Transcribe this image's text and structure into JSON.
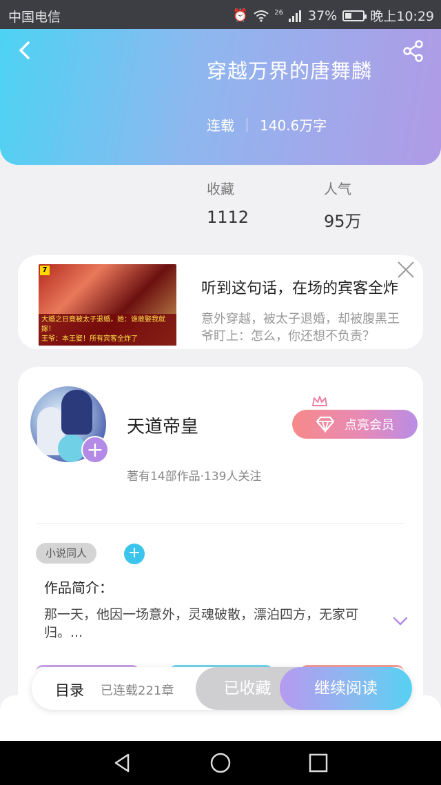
{
  "status_bar": {
    "carrier": "中国电信",
    "battery_pct": "37%",
    "time": "晚上10:29",
    "network": "26"
  },
  "header": {
    "title": "穿越万界的唐舞麟",
    "status": "连载",
    "word_count": "140.6万字"
  },
  "stats": [
    {
      "label": "收藏",
      "value": "1112"
    },
    {
      "label": "人气",
      "value": "95万"
    }
  ],
  "ad": {
    "headline": "听到这句话，在场的宾客全炸",
    "desc_line1": "意外穿越，被太子退婚，却被腹黑王",
    "desc_line2": "爷盯上：怎么，你还想不负责？",
    "image_caption_1": "大婚之日竟被太子退婚，她：谁敢娶我就嫁！",
    "image_caption_2": "王爷：本王娶！所有宾客全炸了"
  },
  "author": {
    "name": "天道帝皇",
    "stats": "著有14部作品·139人关注",
    "vip_label": "点亮会员"
  },
  "book": {
    "tag": "小说同人",
    "intro_label": "作品简介：",
    "intro_text": "那一天，他因一场意外，灵魂破散，漂泊四方，无家可归。..."
  },
  "bottom_bar": {
    "toc_label": "目录",
    "chapter_count": "已连载221章",
    "collected_label": "已收藏",
    "read_label": "继续阅读"
  },
  "colors": {
    "header_gradient_start": "#4dd3f3",
    "header_gradient_end": "#b09ae6",
    "accent_purple": "#b38ae6",
    "accent_cyan": "#3cc5ec"
  }
}
